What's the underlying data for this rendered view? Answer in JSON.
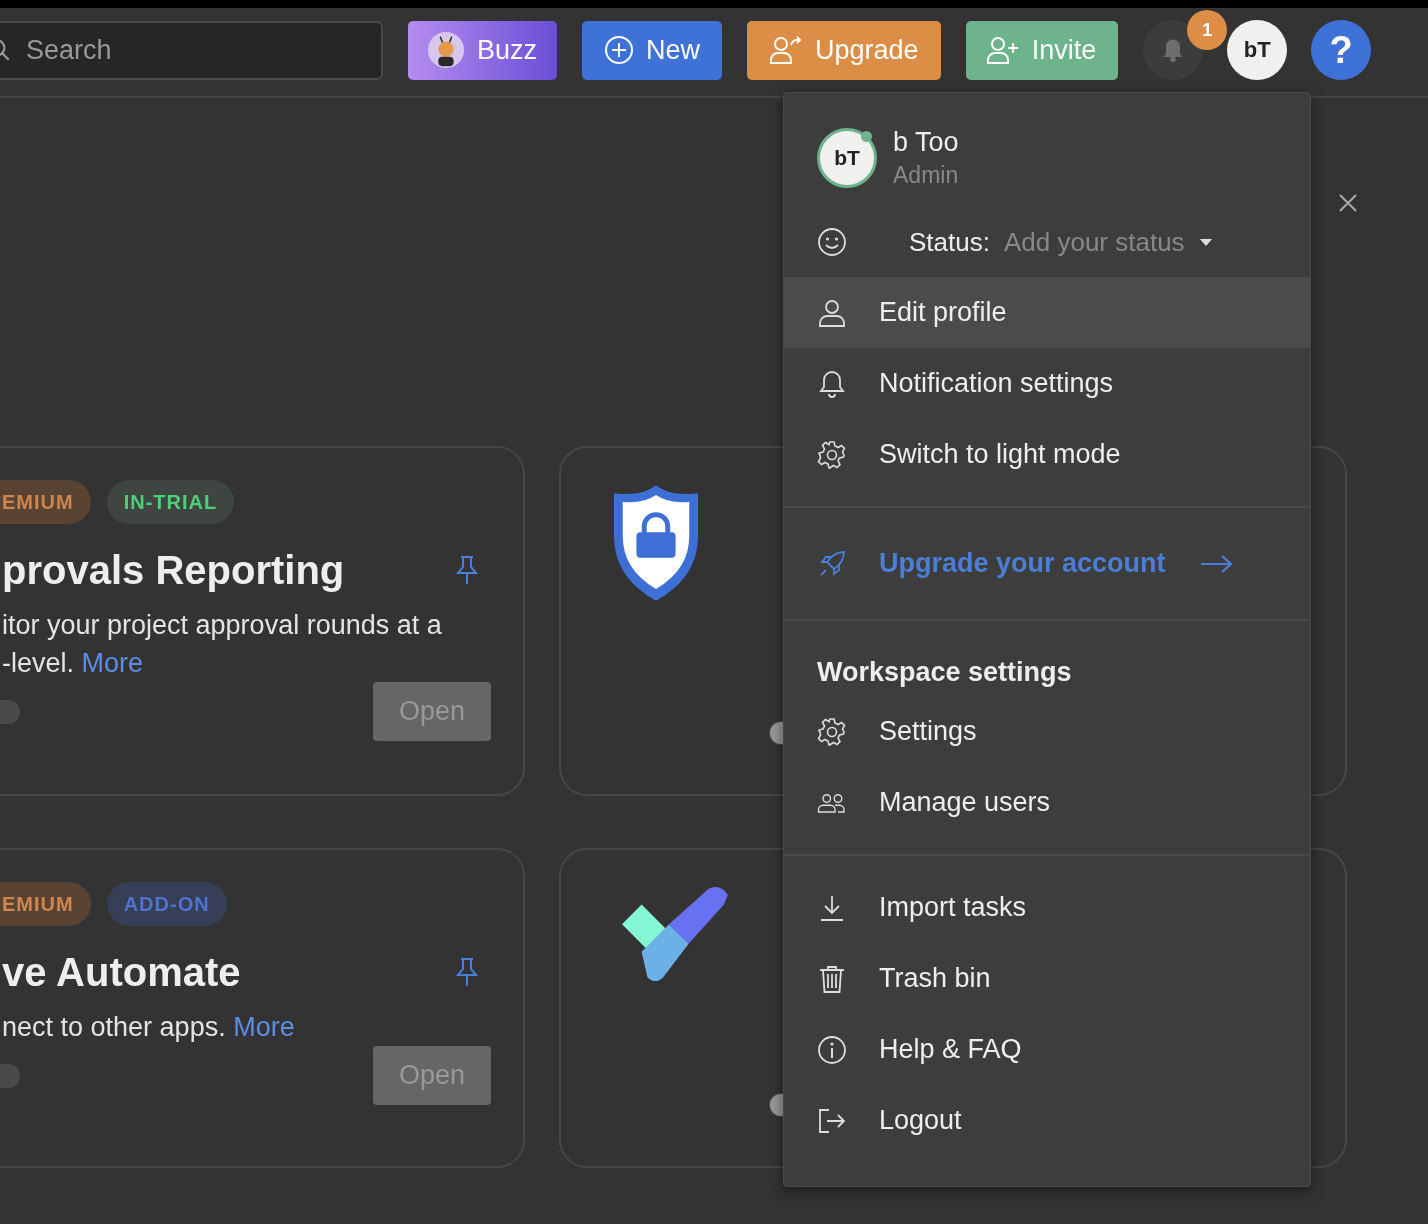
{
  "header": {
    "search": {
      "placeholder": "Search"
    },
    "buttons": [
      {
        "kind": "buzz",
        "label": "Buzz"
      },
      {
        "kind": "new",
        "label": "New"
      },
      {
        "kind": "upgrade",
        "label": "Upgrade"
      },
      {
        "kind": "invite",
        "label": "Invite"
      }
    ],
    "notifications": {
      "badge": "1"
    },
    "avatar": {
      "initials": "bT"
    },
    "help": {
      "label": "?"
    }
  },
  "cards": [
    {
      "tags": [
        {
          "label": "EMIUM",
          "color": "#594333"
        },
        {
          "label": "IN-TRIAL",
          "color": "#3f4541"
        }
      ],
      "title": "provals Reporting",
      "lines": [
        "itor your project approval rounds at a",
        "-level."
      ],
      "link": "More",
      "toggle": {
        "on": false
      },
      "button": "Open"
    },
    {
      "kind": "shield",
      "toggle": {
        "on": false
      }
    },
    {
      "tags": [
        {
          "label": "EMIUM",
          "color": "#594333"
        },
        {
          "label": "ADD-ON",
          "color": "#363f55"
        }
      ],
      "title": "ve Automate",
      "lines": [
        "nect to other apps."
      ],
      "link": "More",
      "toggle": {
        "on": false
      },
      "button": "Open"
    },
    {
      "kind": "check",
      "toggle": {
        "on": false
      }
    }
  ],
  "menu": {
    "profile": {
      "initials": "bT",
      "name": "b Too",
      "role": "Admin",
      "online": true
    },
    "status": {
      "label": "Status:",
      "placeholder": "Add your status"
    },
    "sections": [
      {
        "items": [
          {
            "label": "Edit profile",
            "selected": true
          },
          {
            "label": "Notification settings",
            "selected": false
          },
          {
            "label": "Switch to light mode",
            "selected": false
          }
        ]
      },
      {
        "items": [
          {
            "label": "Upgrade your account",
            "kind": "link",
            "selected": false
          }
        ]
      },
      {
        "heading": "Workspace settings",
        "items": [
          {
            "label": "Settings",
            "selected": false
          },
          {
            "label": "Manage users",
            "selected": false
          }
        ]
      },
      {
        "items": [
          {
            "label": "Import tasks",
            "selected": false
          },
          {
            "label": "Trash bin",
            "selected": false
          },
          {
            "label": "Help & FAQ",
            "selected": false
          },
          {
            "label": "Logout",
            "selected": false
          }
        ]
      }
    ]
  }
}
